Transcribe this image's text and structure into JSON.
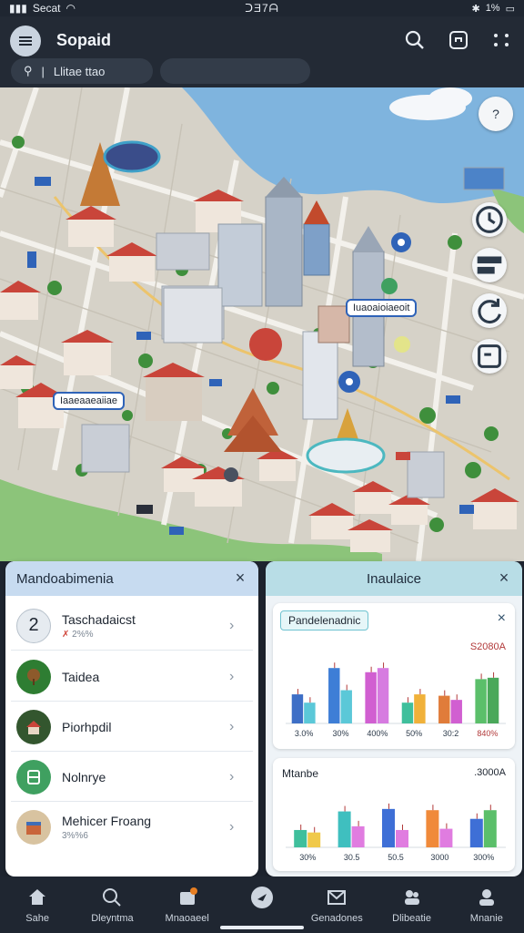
{
  "status_bar": {
    "carrier": "Secat",
    "time": "ᑐƎ7ᗩ",
    "battery": "1%"
  },
  "header": {
    "title": "Sopaid",
    "search_chip_text": "Llitae ttao"
  },
  "map": {
    "labels": [
      {
        "text": "Iuaoaioiaeoit"
      },
      {
        "text": "Iaaeaaeaiiae"
      }
    ],
    "fab_icons": [
      "question-icon",
      "clock-icon",
      "layers-icon",
      "refresh-icon",
      "map-note-icon"
    ],
    "fab_question": "?"
  },
  "left_panel": {
    "title": "Mandoabimenia",
    "close": "×",
    "items": [
      {
        "title": "Taschadaicst",
        "subtitle": "2%%",
        "badge": "2"
      },
      {
        "title": "Taidea",
        "subtitle": ""
      },
      {
        "title": "Piorhpdil",
        "subtitle": ""
      },
      {
        "title": "Nolnrye",
        "subtitle": ""
      },
      {
        "title": "Mehicer Froang",
        "subtitle": "3%%6"
      }
    ]
  },
  "right_panel": {
    "title": "Inaulaice",
    "close": "×",
    "chart1": {
      "title": "Pandelenadnic",
      "value_label": "S2080A",
      "close": "×"
    },
    "chart2": {
      "title": "Mtanbe",
      "value_label": ".3000A"
    }
  },
  "chart_data": [
    {
      "type": "bar",
      "title": "Pandelenadnic",
      "categories": [
        "3.0%",
        "30%",
        "400%",
        "50%",
        "30:2",
        "840%"
      ],
      "series": [
        {
          "values": [
            42,
            80,
            74,
            30,
            40,
            64
          ]
        },
        {
          "values": [
            30,
            48,
            80,
            42,
            34,
            66
          ]
        }
      ],
      "colors": [
        [
          "#3e6fc6",
          "#5bc8d8"
        ],
        [
          "#3e7ed6",
          "#5bc8d8"
        ],
        [
          "#d15fd1",
          "#d67be0"
        ],
        [
          "#3fbf9c",
          "#f0b13a"
        ],
        [
          "#e07c3a",
          "#d15fd1"
        ],
        [
          "#5bbf6a",
          "#4aa85a"
        ]
      ],
      "ylim": [
        0,
        100
      ]
    },
    {
      "type": "bar",
      "title": "Mtanbe",
      "categories": [
        "30%",
        "30.5",
        "50.5",
        "3000",
        "300%"
      ],
      "series": [
        {
          "values": [
            28,
            58,
            62,
            60,
            46
          ]
        },
        {
          "values": [
            24,
            34,
            28,
            30,
            60
          ]
        }
      ],
      "colors": [
        [
          "#3fbf9c",
          "#f0c94a"
        ],
        [
          "#3fbfbf",
          "#e07ce0"
        ],
        [
          "#3e6fd6",
          "#e07ce0"
        ],
        [
          "#f08a3a",
          "#e07ce0"
        ],
        [
          "#3e6fd6",
          "#5bbf6a"
        ]
      ],
      "ylim": [
        0,
        100
      ]
    }
  ],
  "bottom_nav": [
    {
      "label": "Sahe",
      "icon": "home-icon"
    },
    {
      "label": "Dleyntma",
      "icon": "search-icon"
    },
    {
      "label": "Mnaoaeel",
      "icon": "badge-icon"
    },
    {
      "label": "",
      "icon": "plane-icon"
    },
    {
      "label": "Genadones",
      "icon": "mail-icon"
    },
    {
      "label": "Dlibeatie",
      "icon": "people-icon"
    },
    {
      "label": "Mnanie",
      "icon": "profile-icon"
    }
  ]
}
